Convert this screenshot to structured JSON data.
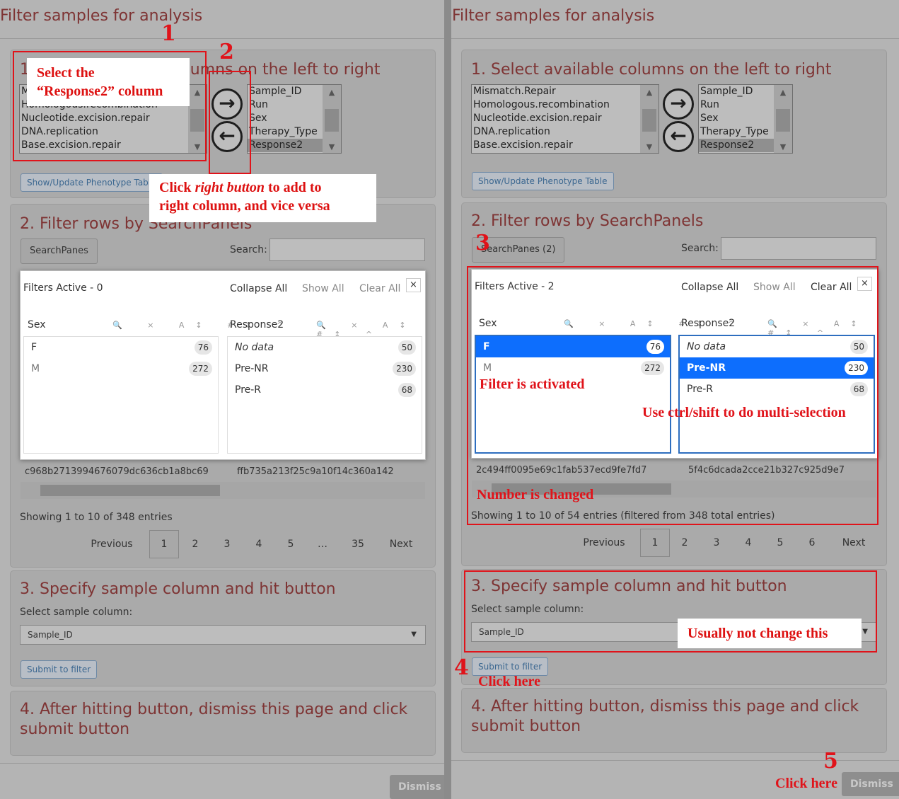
{
  "page_title": "Filter samples for analysis",
  "section1": {
    "title": "1. Select available columns on the left to right",
    "left_list": [
      "Mismatch.Repair",
      "Homologous.recombination",
      "Nucleotide.excision.repair",
      "DNA.replication",
      "Base.excision.repair"
    ],
    "right_list": [
      "Sample_ID",
      "Run",
      "Sex",
      "Therapy_Type",
      "Response2"
    ],
    "add_icon": "arrow-right-icon",
    "remove_icon": "arrow-left-icon",
    "show_button": "Show/Update Phenotype Table"
  },
  "section2": {
    "title": "2. Filter rows by SearchPanels",
    "search_label": "Search:",
    "collapse_all": "Collapse All",
    "show_all": "Show All",
    "clear_all": "Clear All",
    "close": "×",
    "pane_icons": "🔍 × A↕ #↕ ^",
    "next": "Next",
    "previous": "Previous",
    "left": {
      "searchpanes_button": "SearchPanes",
      "filters_active": "Filters Active - 0",
      "pane_sex": {
        "title": "Sex",
        "rows": [
          {
            "label": "F",
            "count": "76"
          },
          {
            "label": "M",
            "count": "272"
          }
        ]
      },
      "pane_resp": {
        "title": "Response2",
        "rows": [
          {
            "label": "No data",
            "count": "50"
          },
          {
            "label": "Pre-NR",
            "count": "230"
          },
          {
            "label": "Pre-R",
            "count": "68"
          }
        ]
      },
      "hash1": "c968b2713994676079dc636cb1a8bc69",
      "hash2": "ffb735a213f25c9a10f14c360a142",
      "showing": "Showing 1 to 10 of 348 entries",
      "pages": [
        "1",
        "2",
        "3",
        "4",
        "5",
        "…",
        "35"
      ]
    },
    "right": {
      "searchpanes_button": "SearchPanes (2)",
      "filters_active": "Filters Active - 2",
      "pane_sex": {
        "title": "Sex",
        "rows": [
          {
            "label": "F",
            "count": "76"
          },
          {
            "label": "M",
            "count": "272"
          }
        ]
      },
      "pane_resp": {
        "title": "Response2",
        "rows": [
          {
            "label": "No data",
            "count": "50"
          },
          {
            "label": "Pre-NR",
            "count": "230"
          },
          {
            "label": "Pre-R",
            "count": "68"
          }
        ]
      },
      "hash1": "2c494ff0095e69c1fab537ecd9fe7fd7",
      "hash2": "5f4c6dcada2cce21b327c925d9e7",
      "showing": "Showing 1 to 10 of 54 entries (filtered from 348 total entries)",
      "pages": [
        "1",
        "2",
        "3",
        "4",
        "5",
        "6"
      ]
    }
  },
  "section3": {
    "title": "3. Specify sample column and hit button",
    "select_label": "Select sample column:",
    "select_value": "Sample_ID",
    "submit": "Submit to filter"
  },
  "section4": {
    "title": "4. After hitting button, dismiss this page and click submit button"
  },
  "dismiss": "Dismiss",
  "annotations": {
    "n1": "1",
    "n2": "2",
    "n3": "3",
    "n4": "4",
    "n5": "5",
    "select_line1": "Select the",
    "select_line2": "“Response2” column",
    "click_pre": "Click ",
    "click_em": "right button",
    "click_post": " to add to",
    "click_line2": "right column, and vice versa",
    "filter_activated": "Filter is activated",
    "multi": "Use ctrl/shift to do multi-selection",
    "number_changed": "Number is changed",
    "usually": "Usually not change this",
    "click_here": "Click here"
  }
}
